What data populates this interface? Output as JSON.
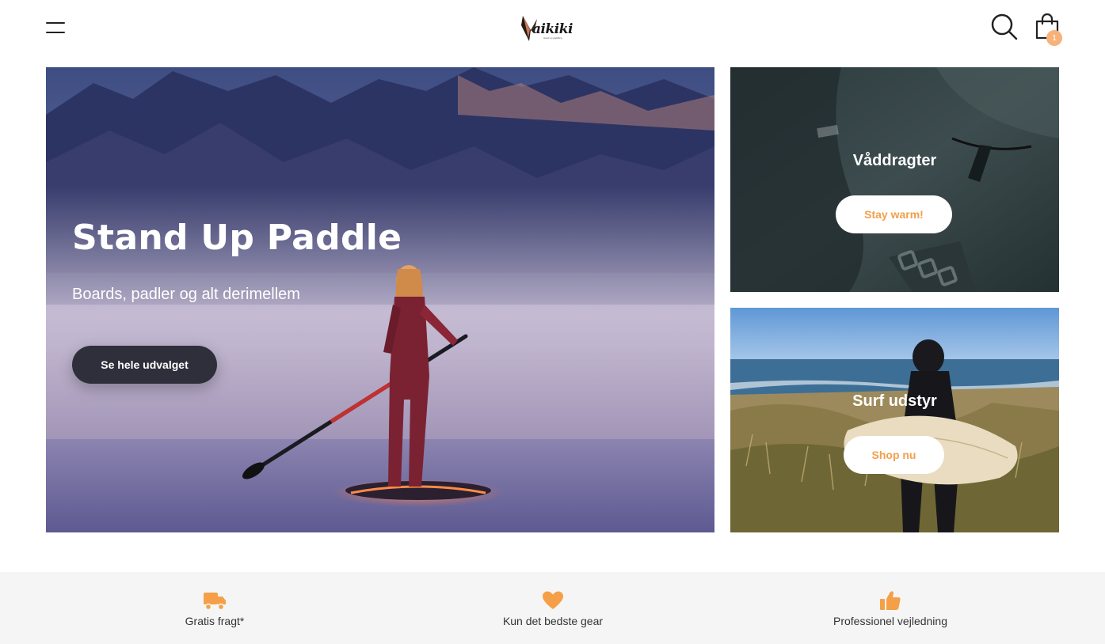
{
  "header": {
    "logo_text": "aikiki",
    "logo_tagline": "stand up paddling",
    "menu_icon": "hamburger-menu-icon",
    "search_icon": "search-icon",
    "cart_icon": "shopping-bag-icon",
    "cart_count": "1"
  },
  "hero": {
    "title": "Stand Up Paddle",
    "subtitle": "Boards, padler og alt derimellem",
    "button_label": "Se hele udvalget"
  },
  "tiles": [
    {
      "title": "Våddragter",
      "button_label": "Stay warm!"
    },
    {
      "title": "Surf udstyr",
      "button_label": "Shop nu"
    }
  ],
  "usps": [
    {
      "icon": "truck-icon",
      "label": "Gratis fragt*"
    },
    {
      "icon": "heart-icon",
      "label": "Kun det bedste gear"
    },
    {
      "icon": "thumbs-up-icon",
      "label": "Professionel vejledning"
    }
  ],
  "colors": {
    "accent": "#f0a04b",
    "icon_orange": "#f5a048",
    "badge": "#f7b27a",
    "dark_button": "#2e2f3a",
    "usp_background": "#f5f5f5"
  }
}
